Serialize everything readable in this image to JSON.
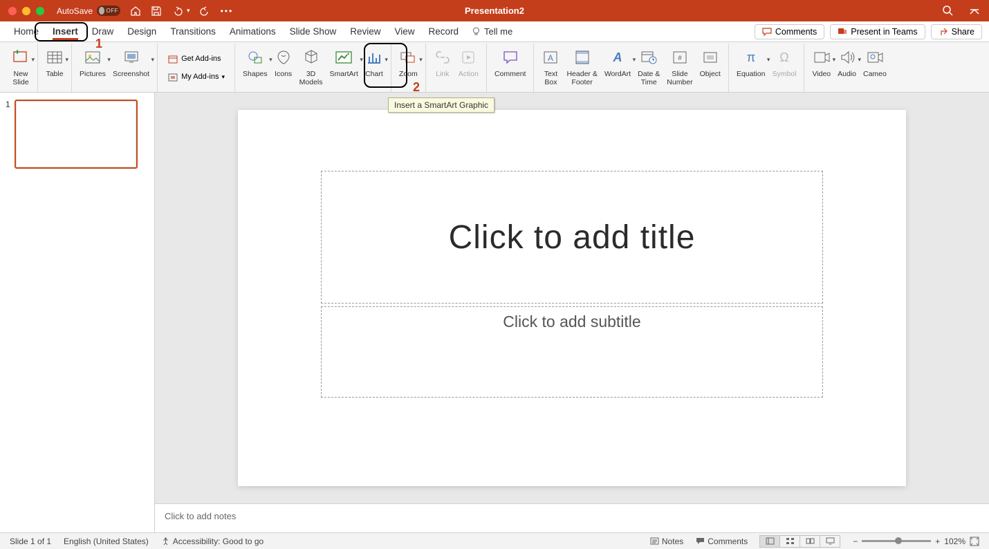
{
  "titlebar": {
    "autosave": "AutoSave",
    "autosave_state": "OFF",
    "title": "Presentation2"
  },
  "tabs": [
    "Home",
    "Insert",
    "Draw",
    "Design",
    "Transitions",
    "Animations",
    "Slide Show",
    "Review",
    "View",
    "Record"
  ],
  "tellme": "Tell me",
  "actions": {
    "comments": "Comments",
    "present": "Present in Teams",
    "share": "Share"
  },
  "ribbon": {
    "new_slide": "New\nSlide",
    "table": "Table",
    "pictures": "Pictures",
    "screenshot": "Screenshot",
    "get_addins": "Get Add-ins",
    "my_addins": "My Add-ins",
    "shapes": "Shapes",
    "icons": "Icons",
    "models": "3D\nModels",
    "smartart": "SmartArt",
    "chart": "Chart",
    "zoom": "Zoom",
    "link": "Link",
    "action": "Action",
    "comment": "Comment",
    "textbox": "Text\nBox",
    "headerfooter": "Header &\nFooter",
    "wordart": "WordArt",
    "datetime": "Date &\nTime",
    "slidenum": "Slide\nNumber",
    "object": "Object",
    "equation": "Equation",
    "symbol": "Symbol",
    "video": "Video",
    "audio": "Audio",
    "cameo": "Cameo"
  },
  "tooltip": "Insert a SmartArt Graphic",
  "slide": {
    "title_placeholder": "Click to add title",
    "subtitle_placeholder": "Click to add subtitle",
    "notes_placeholder": "Click to add notes",
    "thumb_number": "1"
  },
  "status": {
    "slide": "Slide 1 of 1",
    "lang": "English (United States)",
    "access": "Accessibility: Good to go",
    "notes": "Notes",
    "comments": "Comments",
    "zoom_pct": "102%"
  },
  "annotations": {
    "one": "1",
    "two": "2"
  }
}
